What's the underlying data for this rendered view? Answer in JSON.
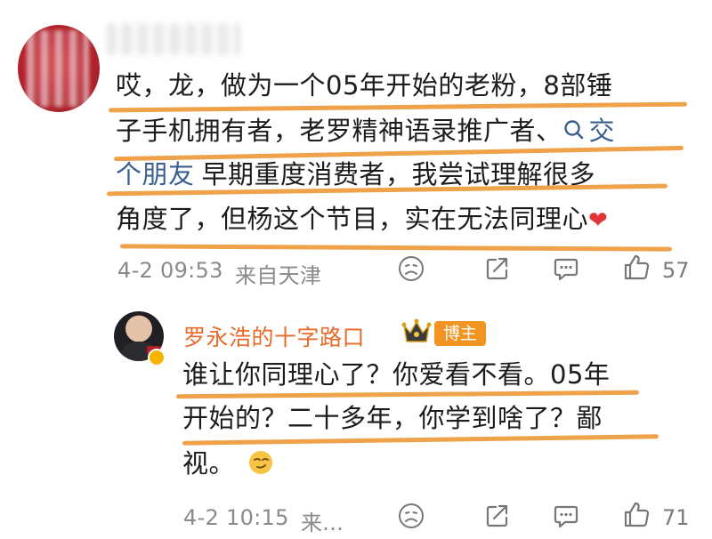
{
  "comment": {
    "lines": [
      "哎，龙，做为一个05年开始的老粉，8部锤",
      "子手机拥有者，老罗精神语录推广者、",
      "早期重度消费者，我尝试理解很多",
      "角度了，但杨这个节目，实在无法同理心"
    ],
    "topic_link_part1": "交",
    "topic_link_part2": "个朋友",
    "heart_emoji": "❤",
    "time": "4-2 09:53",
    "location": "来自天津",
    "like_count": "57"
  },
  "reply": {
    "username": "罗永浩的十字路口",
    "role_badge": "博主",
    "lines": [
      "谁让你同理心了？你爱看不看。05年",
      "开始的？二十多年，你学到啥了？鄙",
      "视。"
    ],
    "time": "4-2 10:15",
    "location": "来...",
    "like_count": "71"
  },
  "icons": {
    "emoji": "face-emoji-icon",
    "repost": "repost-icon",
    "comment": "comment-icon",
    "like": "thumbs-up-icon",
    "topic": "search-icon",
    "crown": "crown-icon",
    "verified": "verified-badge-icon"
  },
  "colors": {
    "highlight": "#ef9a3c",
    "link": "#3a5f8f",
    "username": "#e86a2a",
    "badge": "#f19422",
    "meta": "#8a8a8a"
  }
}
